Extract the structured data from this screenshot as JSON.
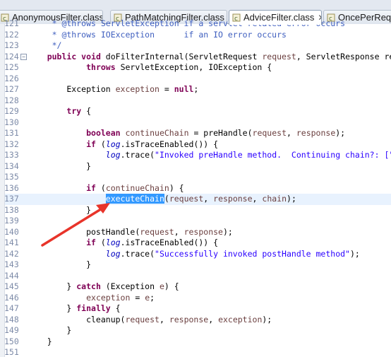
{
  "tabs": [
    {
      "label": "AnonymousFilter.class",
      "active": false
    },
    {
      "label": "PathMatchingFilter.class",
      "active": false
    },
    {
      "label": "AdviceFilter.class",
      "active": true,
      "close": "✕"
    },
    {
      "label": "OncePerRequestFilter.class",
      "active": false
    }
  ],
  "lines": [
    {
      "n": "121",
      "segs": [
        {
          "t": "     * @throws ServletException if a servlet-related error occurs",
          "c": "cm"
        }
      ]
    },
    {
      "n": "122",
      "segs": [
        {
          "t": "     * @throws IOException      if an IO error occurs",
          "c": "cm"
        }
      ]
    },
    {
      "n": "123",
      "segs": [
        {
          "t": "     */",
          "c": "cm"
        }
      ]
    },
    {
      "n": "124",
      "fold": "−",
      "segs": [
        {
          "t": "    ",
          "c": ""
        },
        {
          "t": "public void",
          "c": "kw"
        },
        {
          "t": " doFilterInternal(ServletRequest ",
          "c": ""
        },
        {
          "t": "request",
          "c": "var"
        },
        {
          "t": ", ServletResponse response,",
          "c": ""
        }
      ]
    },
    {
      "n": "125",
      "segs": [
        {
          "t": "            ",
          "c": ""
        },
        {
          "t": "throws",
          "c": "kw"
        },
        {
          "t": " ServletException, IOException {",
          "c": ""
        }
      ]
    },
    {
      "n": "126",
      "segs": []
    },
    {
      "n": "127",
      "segs": [
        {
          "t": "        Exception ",
          "c": ""
        },
        {
          "t": "exception",
          "c": "var"
        },
        {
          "t": " = ",
          "c": ""
        },
        {
          "t": "null",
          "c": "kw"
        },
        {
          "t": ";",
          "c": ""
        }
      ]
    },
    {
      "n": "128",
      "segs": []
    },
    {
      "n": "129",
      "segs": [
        {
          "t": "        ",
          "c": ""
        },
        {
          "t": "try",
          "c": "kw"
        },
        {
          "t": " {",
          "c": ""
        }
      ]
    },
    {
      "n": "130",
      "segs": []
    },
    {
      "n": "131",
      "segs": [
        {
          "t": "            ",
          "c": ""
        },
        {
          "t": "boolean",
          "c": "kw"
        },
        {
          "t": " ",
          "c": ""
        },
        {
          "t": "continueChain",
          "c": "var"
        },
        {
          "t": " = preHandle(",
          "c": ""
        },
        {
          "t": "request",
          "c": "var"
        },
        {
          "t": ", ",
          "c": ""
        },
        {
          "t": "response",
          "c": "var"
        },
        {
          "t": ");",
          "c": ""
        }
      ]
    },
    {
      "n": "132",
      "segs": [
        {
          "t": "            ",
          "c": ""
        },
        {
          "t": "if",
          "c": "kw"
        },
        {
          "t": " (",
          "c": ""
        },
        {
          "t": "log",
          "c": "fld"
        },
        {
          "t": ".isTraceEnabled()) {",
          "c": ""
        }
      ]
    },
    {
      "n": "133",
      "segs": [
        {
          "t": "                ",
          "c": ""
        },
        {
          "t": "log",
          "c": "fld"
        },
        {
          "t": ".trace(",
          "c": ""
        },
        {
          "t": "\"Invoked preHandle method.  Continuing chain?: [\"",
          "c": "str"
        }
      ]
    },
    {
      "n": "134",
      "segs": [
        {
          "t": "            }",
          "c": ""
        }
      ]
    },
    {
      "n": "135",
      "segs": []
    },
    {
      "n": "136",
      "segs": [
        {
          "t": "            ",
          "c": ""
        },
        {
          "t": "if",
          "c": "kw"
        },
        {
          "t": " (",
          "c": ""
        },
        {
          "t": "continueChain",
          "c": "var"
        },
        {
          "t": ") {",
          "c": ""
        }
      ]
    },
    {
      "n": "137",
      "current": true,
      "segs": [
        {
          "t": "                ",
          "c": ""
        },
        {
          "t": "executeChain",
          "c": "sel"
        },
        {
          "t": "(",
          "c": ""
        },
        {
          "t": "request",
          "c": "var"
        },
        {
          "t": ", ",
          "c": ""
        },
        {
          "t": "response",
          "c": "var"
        },
        {
          "t": ", ",
          "c": ""
        },
        {
          "t": "chain",
          "c": "var"
        },
        {
          "t": ");",
          "c": ""
        }
      ]
    },
    {
      "n": "138",
      "segs": [
        {
          "t": "            }",
          "c": ""
        }
      ]
    },
    {
      "n": "139",
      "segs": []
    },
    {
      "n": "140",
      "segs": [
        {
          "t": "            postHandle(",
          "c": ""
        },
        {
          "t": "request",
          "c": "var"
        },
        {
          "t": ", ",
          "c": ""
        },
        {
          "t": "response",
          "c": "var"
        },
        {
          "t": ");",
          "c": ""
        }
      ]
    },
    {
      "n": "141",
      "segs": [
        {
          "t": "            ",
          "c": ""
        },
        {
          "t": "if",
          "c": "kw"
        },
        {
          "t": " (",
          "c": ""
        },
        {
          "t": "log",
          "c": "fld"
        },
        {
          "t": ".isTraceEnabled()) {",
          "c": ""
        }
      ]
    },
    {
      "n": "142",
      "segs": [
        {
          "t": "                ",
          "c": ""
        },
        {
          "t": "log",
          "c": "fld"
        },
        {
          "t": ".trace(",
          "c": ""
        },
        {
          "t": "\"Successfully invoked postHandle method\"",
          "c": "str"
        },
        {
          "t": ");",
          "c": ""
        }
      ]
    },
    {
      "n": "143",
      "segs": [
        {
          "t": "            }",
          "c": ""
        }
      ]
    },
    {
      "n": "144",
      "segs": []
    },
    {
      "n": "145",
      "segs": [
        {
          "t": "        } ",
          "c": ""
        },
        {
          "t": "catch",
          "c": "kw"
        },
        {
          "t": " (Exception ",
          "c": ""
        },
        {
          "t": "e",
          "c": "var"
        },
        {
          "t": ") {",
          "c": ""
        }
      ]
    },
    {
      "n": "146",
      "segs": [
        {
          "t": "            ",
          "c": ""
        },
        {
          "t": "exception",
          "c": "var"
        },
        {
          "t": " = ",
          "c": ""
        },
        {
          "t": "e",
          "c": "var"
        },
        {
          "t": ";",
          "c": ""
        }
      ]
    },
    {
      "n": "147",
      "segs": [
        {
          "t": "        } ",
          "c": ""
        },
        {
          "t": "finally",
          "c": "kw"
        },
        {
          "t": " {",
          "c": ""
        }
      ]
    },
    {
      "n": "148",
      "segs": [
        {
          "t": "            cleanup(",
          "c": ""
        },
        {
          "t": "request",
          "c": "var"
        },
        {
          "t": ", ",
          "c": ""
        },
        {
          "t": "response",
          "c": "var"
        },
        {
          "t": ", ",
          "c": ""
        },
        {
          "t": "exception",
          "c": "var"
        },
        {
          "t": ");",
          "c": ""
        }
      ]
    },
    {
      "n": "149",
      "segs": [
        {
          "t": "        }",
          "c": ""
        }
      ]
    },
    {
      "n": "150",
      "segs": [
        {
          "t": "    }",
          "c": ""
        }
      ]
    },
    {
      "n": "151",
      "segs": []
    }
  ],
  "annotation": {
    "color": "#e8342a"
  }
}
